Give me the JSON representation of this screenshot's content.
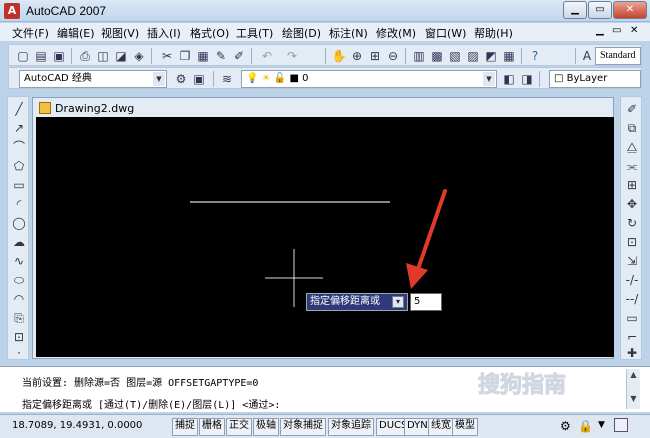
{
  "window": {
    "title": "AutoCAD 2007"
  },
  "menu": [
    "文件(F)",
    "编辑(E)",
    "视图(V)",
    "插入(I)",
    "格式(O)",
    "工具(T)",
    "绘图(D)",
    "标注(N)",
    "修改(M)",
    "窗口(W)",
    "帮助(H)"
  ],
  "toolbar": {
    "text_style": "Standard"
  },
  "toolbar2": {
    "workspace": "AutoCAD 经典",
    "layer": "0",
    "color": "ByLayer"
  },
  "drawing": {
    "tab_title": "Drawing2.dwg"
  },
  "dynamic_input": {
    "prompt": "指定偏移距离或",
    "value": "5"
  },
  "command": {
    "line1": "当前设置: 删除源=否  图层=源  OFFSETGAPTYPE=0",
    "line2": "指定偏移距离或 [通过(T)/删除(E)/图层(L)] <通过>:"
  },
  "status": {
    "coords": "18.7089, 19.4931, 0.0000",
    "toggles": [
      "捕捉",
      "栅格",
      "正交",
      "极轴",
      "对象捕捉",
      "对象追踪",
      "DUCS",
      "DYN",
      "线宽",
      "模型"
    ]
  },
  "watermark": "搜狗指南",
  "colors": {
    "canvas": "#000000",
    "arrow": "#e03a2a",
    "prompt_bg": "#2e3a7a"
  }
}
